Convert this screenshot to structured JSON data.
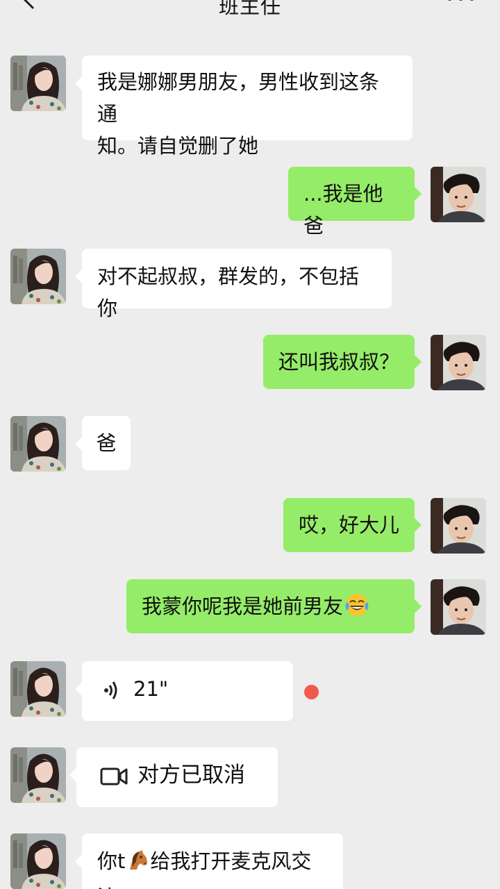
{
  "header": {
    "title": "班主任",
    "back_icon": "back-arrow-icon",
    "more_icon": "more-dots-icon"
  },
  "messages": [
    {
      "side": "in",
      "type": "text",
      "lines": [
        "我是娜娜男朋友，男性收到这条通",
        "知。请自觉删了她"
      ]
    },
    {
      "side": "out",
      "type": "text",
      "text": "...我是他爸"
    },
    {
      "side": "in",
      "type": "text",
      "text": "对不起叔叔，群发的，不包括你"
    },
    {
      "side": "out",
      "type": "text",
      "text": "还叫我叔叔？"
    },
    {
      "side": "in",
      "type": "text",
      "text": "爸"
    },
    {
      "side": "out",
      "type": "text",
      "text": "哎，好大儿"
    },
    {
      "side": "out",
      "type": "text",
      "text": "我蒙你呢我是她前男友",
      "emoji": "tears-of-joy-emoji"
    },
    {
      "side": "in",
      "type": "voice",
      "duration": "21\"",
      "unread": true
    },
    {
      "side": "in",
      "type": "video_call",
      "text": "对方已取消"
    },
    {
      "side": "in",
      "type": "text",
      "text_before": "你t",
      "emoji": "horse-emoji",
      "text_after": "给我打开麦克风交流"
    }
  ],
  "colors": {
    "background": "#ededed",
    "incoming_bubble": "#ffffff",
    "outgoing_bubble": "#95ec69",
    "unread_dot": "#f05a4a"
  }
}
